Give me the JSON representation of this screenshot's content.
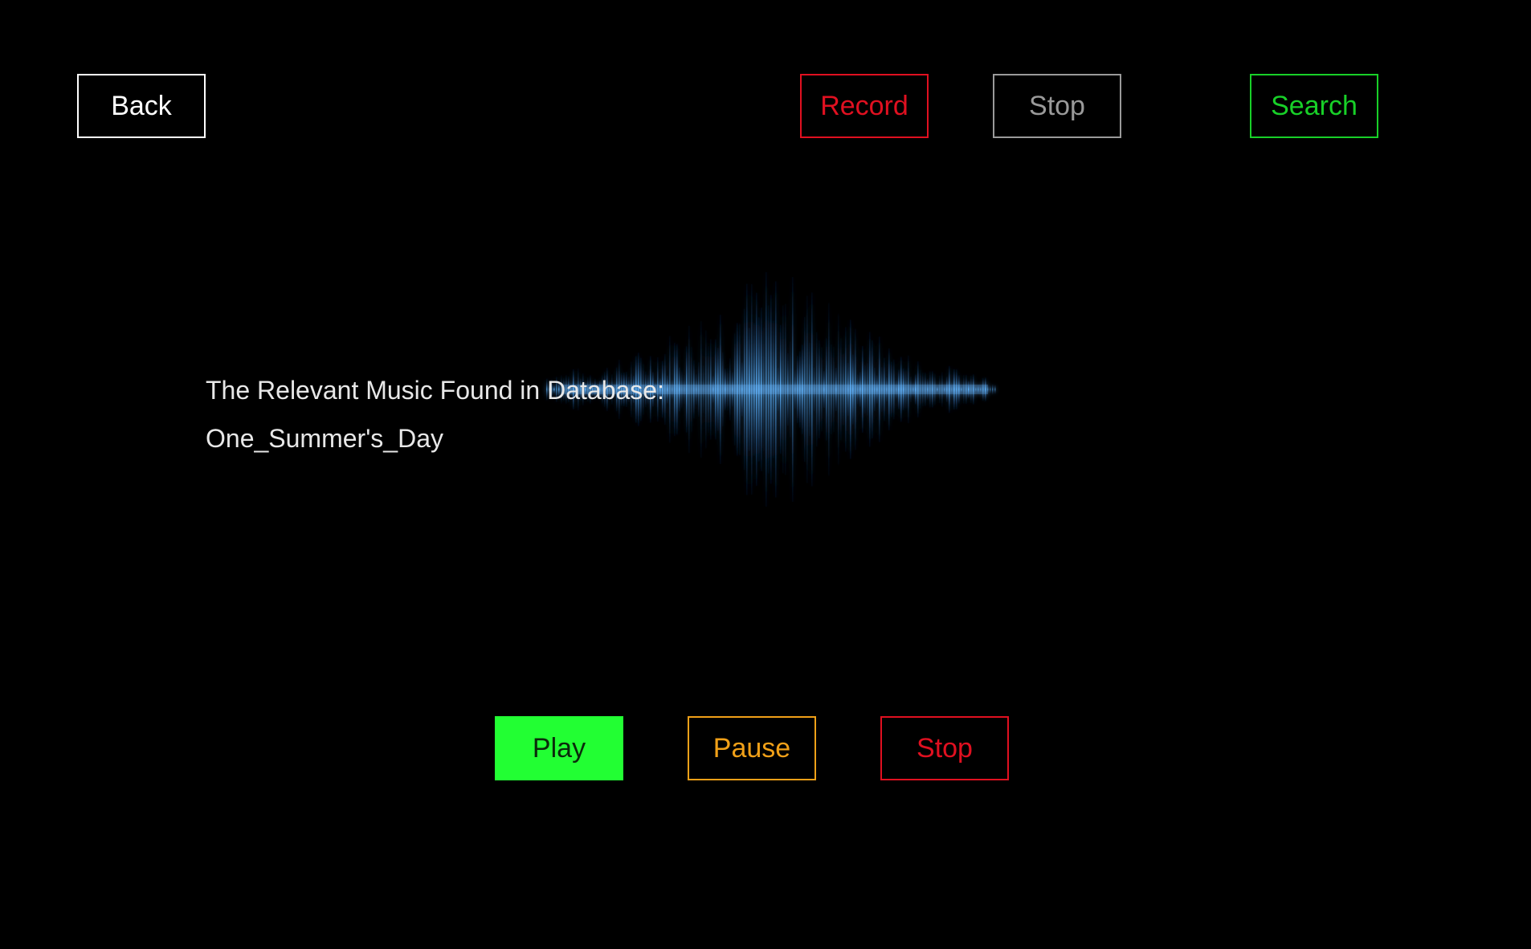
{
  "toolbar": {
    "back_label": "Back",
    "record_label": "Record",
    "stop_label": "Stop",
    "search_label": "Search"
  },
  "result": {
    "label": "The Relevant Music Found in Database:",
    "song": "One_Summer's_Day"
  },
  "playback": {
    "play_label": "Play",
    "pause_label": "Pause",
    "stop_label": "Stop"
  },
  "colors": {
    "background": "#000000",
    "record": "#e01020",
    "search": "#18d028",
    "play": "#22ff33",
    "pause": "#f0a018",
    "waveform": "#2a7fd8"
  }
}
